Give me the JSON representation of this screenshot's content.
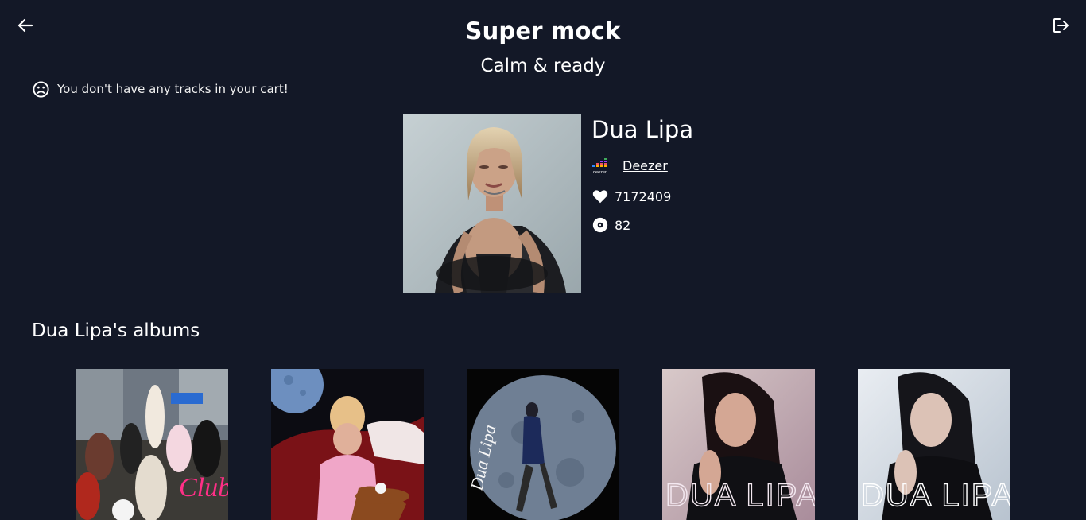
{
  "header": {
    "title": "Super mock",
    "subtitle": "Calm & ready",
    "back_icon": "arrow-left-icon",
    "logout_icon": "logout-icon"
  },
  "cart": {
    "message": "You don't have any tracks in your cart!",
    "icon": "sad-face-icon"
  },
  "artist": {
    "name": "Dua Lipa",
    "source_label": "Deezer",
    "source_icon": "deezer-logo-icon",
    "fans": "7172409",
    "fans_icon": "heart-icon",
    "album_count": "82",
    "albums_icon": "disc-icon"
  },
  "albums_section": {
    "heading": "Dua Lipa's albums",
    "albums": [
      {
        "cover_text": "Club"
      },
      {
        "cover_text": ""
      },
      {
        "cover_text": "Dua Lipa"
      },
      {
        "cover_text": "DUA LIPA"
      },
      {
        "cover_text": "DUA LIPA"
      }
    ]
  },
  "colors": {
    "background": "#131827",
    "text": "#ffffff"
  }
}
